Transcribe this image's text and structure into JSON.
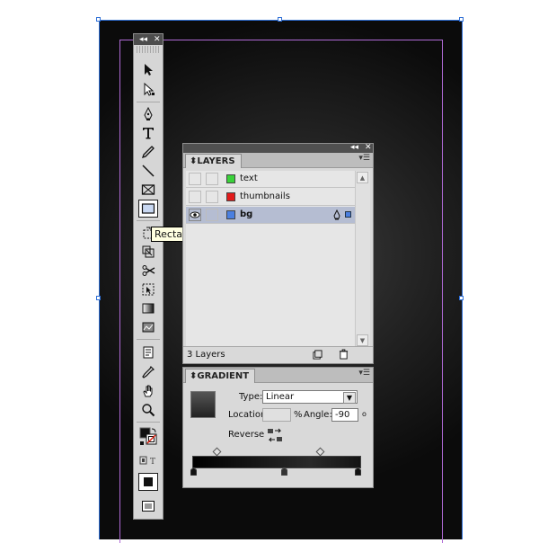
{
  "tooltip": "Rectangle Tool (M)",
  "layers_panel": {
    "tab": "LAYERS",
    "layers": [
      {
        "name": "text",
        "color": "#3ad23a",
        "selected": false,
        "visible": false
      },
      {
        "name": "thumbnails",
        "color": "#e21b1b",
        "selected": false,
        "visible": false
      },
      {
        "name": "bg",
        "color": "#4a7fe0",
        "selected": true,
        "visible": true
      }
    ],
    "count_label": "3 Layers"
  },
  "gradient_panel": {
    "tab": "GRADIENT",
    "type_label": "Type:",
    "type_value": "Linear",
    "location_label": "Location:",
    "percent": "%",
    "angle_label": "Angle:",
    "angle_value": "-90",
    "degree": "o",
    "reverse_label": "Reverse"
  },
  "tools": [
    "selection-tool",
    "direct-selection-tool",
    "pen-tool",
    "type-tool",
    "pencil-tool",
    "line-tool",
    "rectangle-frame-tool",
    "rectangle-tool",
    "rotate-tool",
    "scale-tool",
    "scissors-tool",
    "free-transform-tool",
    "gradient-swatch-tool",
    "gradient-feather-tool",
    "note-tool",
    "eyedropper-tool",
    "hand-tool",
    "zoom-tool"
  ]
}
